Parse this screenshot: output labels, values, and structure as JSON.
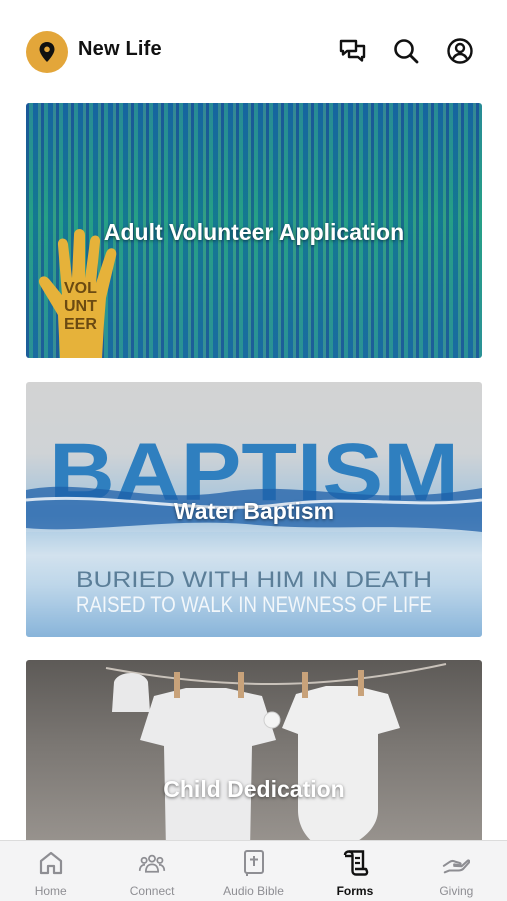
{
  "header": {
    "title": "New Life",
    "logo_icon": "location-pin-icon",
    "actions": [
      {
        "name": "chat-icon"
      },
      {
        "name": "search-icon"
      },
      {
        "name": "account-icon"
      }
    ]
  },
  "cards": [
    {
      "label": "Adult Volunteer Application",
      "art_text": [
        "VOL",
        "UNT",
        "EER"
      ]
    },
    {
      "label": "Water Baptism",
      "art_text": [
        "BAPTISM",
        "BURIED WITH HIM IN DEATH",
        "RAISED TO WALK IN NEWNESS OF LIFE"
      ]
    },
    {
      "label": "Child Dedication"
    }
  ],
  "tabbar": {
    "tabs": [
      {
        "label": "Home",
        "icon": "home-icon",
        "active": false
      },
      {
        "label": "Connect",
        "icon": "people-icon",
        "active": false
      },
      {
        "label": "Audio Bible",
        "icon": "bible-icon",
        "active": false
      },
      {
        "label": "Forms",
        "icon": "forms-icon",
        "active": true
      },
      {
        "label": "Giving",
        "icon": "giving-hand-icon",
        "active": false
      }
    ]
  },
  "colors": {
    "logo_bg": "#e3a63a",
    "tab_inactive": "#8e8e93",
    "tab_active": "#111111"
  }
}
